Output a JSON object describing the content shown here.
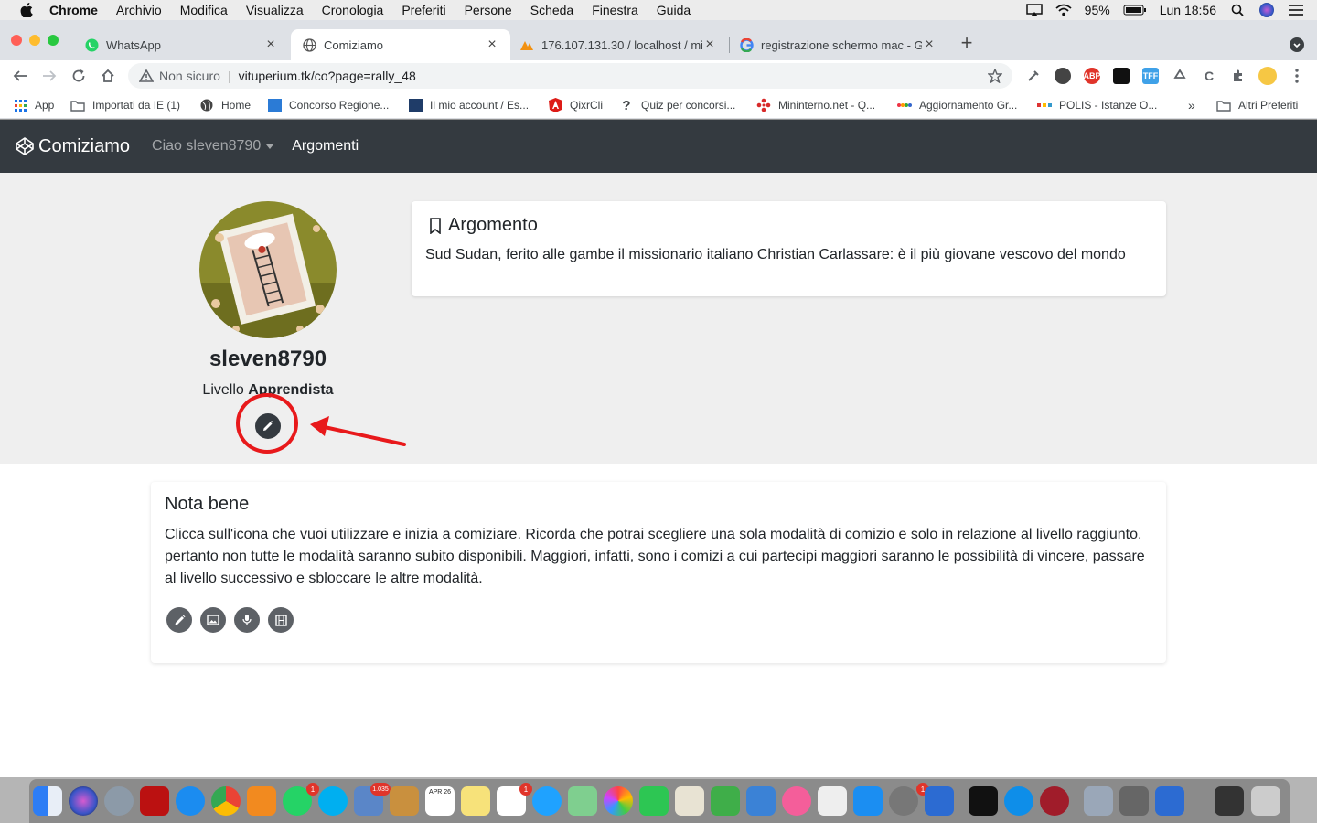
{
  "menubar": {
    "app": "Chrome",
    "items": [
      "Archivio",
      "Modifica",
      "Visualizza",
      "Cronologia",
      "Preferiti",
      "Persone",
      "Scheda",
      "Finestra",
      "Guida"
    ],
    "battery": "95%",
    "clock": "Lun 18:56"
  },
  "tabs": [
    {
      "title": "WhatsApp",
      "icon": "whatsapp-icon"
    },
    {
      "title": "Comiziamo",
      "icon": "globe-icon"
    },
    {
      "title": "176.107.131.30 / localhost / mi",
      "icon": "phpmyadmin-icon"
    },
    {
      "title": "registrazione schermo mac - G",
      "icon": "google-icon"
    }
  ],
  "toolbar": {
    "security": "Non sicuro",
    "url": "vituperium.tk/co?page=rally_48"
  },
  "bookmarks": [
    "App",
    "Importati da IE (1)",
    "Home",
    "Concorso Regione...",
    "Il mio account / Es...",
    "QixrCli",
    "Quiz per concorsi...",
    "Mininterno.net - Q...",
    "Aggiornamento Gr...",
    "POLIS - Istanze O...",
    "»",
    "Altri Preferiti"
  ],
  "site": {
    "brand": "Comiziamo",
    "user_menu": "Ciao sleven8790",
    "nav_link": "Argomenti"
  },
  "profile": {
    "username": "sleven8790",
    "level_prefix": "Livello",
    "level": "Apprendista"
  },
  "argomento": {
    "title": "Argomento",
    "text": "Sud Sudan, ferito alle gambe il missionario italiano Christian Carlassare: è il più giovane vescovo del mondo"
  },
  "nota": {
    "title": "Nota bene",
    "text": "Clicca sull'icona che vuoi utilizzare e inizia a comiziare. Ricorda che potrai scegliere una sola modalità di comizio e solo in relazione al livello raggiunto, pertanto non tutte le modalità saranno subito disponibili. Maggiori, infatti, sono i comizi a cui partecipi maggiori saranno le possibilità di vincere, passare al livello successivo e sbloccare le altre modalità.",
    "modes": [
      "pencil-icon",
      "image-icon",
      "microphone-icon",
      "film-icon"
    ]
  },
  "dock": {
    "badges": [
      "1",
      "1.035",
      "APR 26",
      "1",
      "1"
    ]
  },
  "colors": {
    "navbar": "#343a40",
    "jumbotron": "#efefef",
    "annotation": "#e8191b"
  }
}
